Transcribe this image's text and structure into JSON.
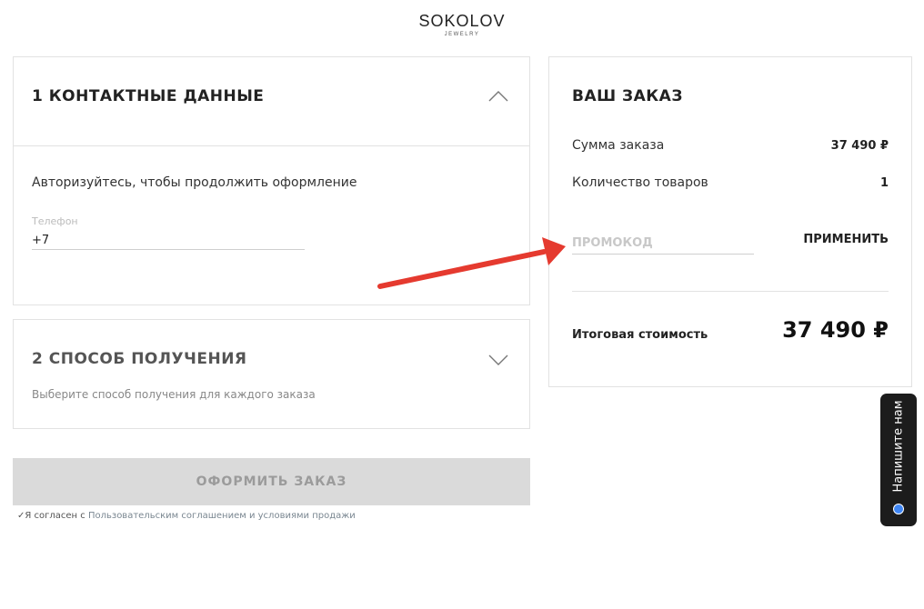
{
  "brand": {
    "name": "SOKOLOV",
    "tagline": "JEWELRY"
  },
  "contact_section": {
    "title": "1 КОНТАКТНЫЕ ДАННЫЕ",
    "auth_prompt": "Авторизуйтесь, чтобы продолжить оформление",
    "phone_label": "Телефон",
    "phone_value": "+7",
    "expanded": true
  },
  "delivery_section": {
    "title": "2 СПОСОБ ПОЛУЧЕНИЯ",
    "description": "Выберите способ получения для каждого заказа",
    "expanded": false
  },
  "order_button": {
    "label": "ОФОРМИТЬ ЗАКАЗ",
    "disabled": true
  },
  "agreement": {
    "check_mark": "✓",
    "prefix": "Я согласен с ",
    "link_text": "Пользовательским соглашением и условиями продажи"
  },
  "summary": {
    "title": "ВАШ ЗАКАЗ",
    "order_sum_label": "Сумма заказа",
    "order_sum_value": "37 490 ₽",
    "items_count_label": "Количество товаров",
    "items_count_value": "1",
    "promo_placeholder": "ПРОМОКОД",
    "apply_label": "ПРИМЕНИТЬ",
    "total_label": "Итоговая стоимость",
    "total_value": "37 490 ₽"
  },
  "chat_widget": {
    "label": "Напишите нам",
    "status_color": "#3f86f4"
  },
  "colors": {
    "annotation_arrow": "#e53a2f",
    "disabled_button_bg": "#dadada",
    "chat_widget_bg": "#1c1c1c"
  }
}
